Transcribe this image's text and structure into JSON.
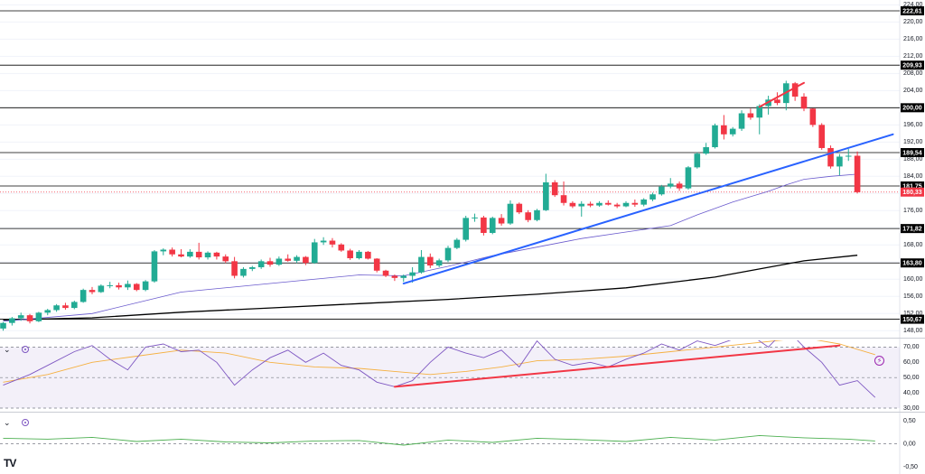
{
  "platform": {
    "logo_text": "TV"
  },
  "panes": {
    "rsi_toggle": "⌄",
    "macd_toggle": "⌄",
    "alert_icon": "⚡"
  },
  "colors": {
    "up": "#22ab94",
    "down": "#f23645",
    "ma50": "#6a5acd",
    "ma200": "#000000",
    "trend_up": "#2962ff",
    "trend_red": "#f23645",
    "rsi": "#7e57c2",
    "rsi_ma": "#f5b041",
    "macd_line": "#4caf50",
    "hline": "#000000",
    "current_price_label": "#f23645"
  },
  "chart_data": [
    {
      "type": "candlestick",
      "title": "",
      "y_axis_ticks": [
        "224,00",
        "220,00",
        "216,00",
        "212,00",
        "208,00",
        "204,00",
        "200,00",
        "196,00",
        "192,00",
        "188,00",
        "184,00",
        "180,00",
        "176,00",
        "172,00",
        "168,00",
        "164,00",
        "160,00",
        "156,00",
        "152,00",
        "148,00"
      ],
      "ylim": [
        147,
        224.5
      ],
      "horizontal_levels": [
        {
          "value": 222.61,
          "label": "222,61"
        },
        {
          "value": 209.93,
          "label": "209,93"
        },
        {
          "value": 200.0,
          "label": "200,00"
        },
        {
          "value": 189.54,
          "label": "189,54"
        },
        {
          "value": 181.75,
          "label": "181,75"
        },
        {
          "value": 171.82,
          "label": "171,82"
        },
        {
          "value": 163.8,
          "label": "163,80"
        },
        {
          "value": 150.67,
          "label": "150,67"
        }
      ],
      "current_price": {
        "value": 180.33,
        "label": "180,33"
      },
      "candles": [
        [
          148.5,
          150.0,
          148.0,
          149.8
        ],
        [
          149.8,
          151.2,
          149.2,
          150.9
        ],
        [
          150.9,
          152.2,
          150.3,
          151.6
        ],
        [
          151.6,
          151.9,
          149.7,
          150.2
        ],
        [
          150.2,
          152.4,
          150.0,
          152.2
        ],
        [
          152.2,
          153.1,
          151.6,
          152.8
        ],
        [
          152.8,
          154.2,
          152.4,
          153.9
        ],
        [
          153.9,
          154.5,
          152.9,
          153.3
        ],
        [
          153.3,
          155.0,
          153.0,
          154.7
        ],
        [
          154.7,
          157.8,
          154.5,
          157.5
        ],
        [
          157.5,
          158.2,
          156.5,
          157.0
        ],
        [
          157.0,
          158.8,
          156.8,
          158.5
        ],
        [
          158.5,
          159.4,
          157.9,
          158.6
        ],
        [
          158.6,
          159.2,
          157.6,
          158.1
        ],
        [
          158.1,
          159.7,
          157.5,
          158.9
        ],
        [
          158.9,
          159.1,
          157.2,
          157.5
        ],
        [
          157.5,
          159.8,
          157.2,
          159.5
        ],
        [
          159.5,
          166.8,
          159.2,
          166.5
        ],
        [
          166.5,
          167.2,
          165.6,
          166.9
        ],
        [
          166.9,
          167.4,
          165.3,
          165.8
        ],
        [
          165.8,
          167.0,
          165.1,
          165.3
        ],
        [
          165.3,
          167.0,
          165.0,
          166.4
        ],
        [
          166.4,
          168.5,
          164.6,
          165.1
        ],
        [
          165.1,
          166.5,
          164.6,
          166.2
        ],
        [
          166.2,
          166.4,
          164.6,
          165.3
        ],
        [
          165.3,
          165.8,
          163.8,
          164.2
        ],
        [
          164.2,
          165.2,
          160.2,
          160.8
        ],
        [
          160.8,
          162.8,
          160.4,
          162.4
        ],
        [
          162.4,
          163.1,
          161.9,
          162.8
        ],
        [
          162.8,
          164.6,
          162.4,
          164.2
        ],
        [
          164.2,
          165.0,
          162.9,
          163.4
        ],
        [
          163.4,
          165.3,
          163.1,
          164.8
        ],
        [
          164.8,
          165.8,
          164.1,
          164.3
        ],
        [
          164.3,
          165.6,
          163.8,
          165.2
        ],
        [
          165.2,
          165.4,
          163.3,
          163.8
        ],
        [
          163.8,
          169.4,
          163.6,
          168.6
        ],
        [
          168.6,
          169.8,
          168.0,
          169.0
        ],
        [
          169.0,
          169.6,
          167.4,
          168.1
        ],
        [
          168.1,
          168.4,
          166.4,
          166.7
        ],
        [
          166.7,
          167.1,
          164.5,
          164.9
        ],
        [
          164.9,
          166.8,
          164.6,
          166.4
        ],
        [
          166.4,
          166.6,
          164.6,
          164.8
        ],
        [
          164.8,
          164.9,
          161.6,
          162.0
        ],
        [
          162.0,
          162.2,
          160.5,
          160.8
        ],
        [
          160.8,
          161.1,
          159.6,
          160.3
        ],
        [
          160.3,
          161.1,
          159.4,
          160.8
        ],
        [
          160.8,
          162.8,
          159.2,
          161.6
        ],
        [
          161.6,
          166.8,
          161.3,
          165.2
        ],
        [
          165.2,
          166.0,
          162.6,
          163.2
        ],
        [
          163.2,
          164.8,
          162.8,
          164.4
        ],
        [
          164.4,
          167.8,
          164.0,
          167.3
        ],
        [
          167.3,
          169.6,
          167.0,
          169.2
        ],
        [
          169.2,
          174.8,
          168.8,
          174.3
        ],
        [
          174.3,
          175.3,
          173.4,
          174.4
        ],
        [
          174.4,
          174.8,
          170.2,
          170.8
        ],
        [
          170.8,
          174.6,
          170.5,
          174.3
        ],
        [
          174.3,
          175.2,
          172.5,
          173.0
        ],
        [
          173.0,
          178.4,
          172.7,
          177.6
        ],
        [
          177.6,
          177.9,
          175.2,
          175.6
        ],
        [
          175.6,
          176.1,
          173.3,
          173.8
        ],
        [
          173.8,
          176.4,
          173.5,
          176.1
        ],
        [
          176.1,
          184.6,
          175.9,
          182.6
        ],
        [
          182.6,
          183.1,
          179.2,
          179.6
        ],
        [
          179.6,
          182.8,
          177.2,
          177.8
        ],
        [
          177.8,
          178.2,
          176.6,
          177.0
        ],
        [
          177.0,
          178.2,
          174.6,
          177.6
        ],
        [
          177.6,
          178.1,
          176.8,
          177.2
        ],
        [
          177.2,
          178.2,
          176.9,
          177.8
        ],
        [
          177.8,
          178.4,
          177.2,
          177.4
        ],
        [
          177.4,
          177.8,
          176.6,
          177.0
        ],
        [
          177.0,
          178.2,
          176.8,
          177.8
        ],
        [
          177.8,
          178.6,
          176.9,
          177.4
        ],
        [
          177.4,
          178.9,
          177.0,
          178.6
        ],
        [
          178.6,
          180.2,
          178.2,
          179.8
        ],
        [
          179.8,
          182.0,
          179.5,
          181.6
        ],
        [
          181.6,
          183.6,
          181.2,
          182.3
        ],
        [
          182.3,
          182.8,
          180.6,
          181.2
        ],
        [
          181.2,
          186.4,
          180.9,
          186.1
        ],
        [
          186.1,
          189.6,
          185.8,
          189.3
        ],
        [
          189.3,
          191.8,
          189.0,
          190.8
        ],
        [
          190.8,
          196.3,
          190.5,
          195.9
        ],
        [
          195.9,
          198.3,
          192.6,
          193.8
        ],
        [
          193.8,
          195.5,
          193.3,
          195.1
        ],
        [
          195.1,
          199.4,
          194.6,
          198.7
        ],
        [
          198.7,
          199.8,
          197.2,
          197.7
        ],
        [
          197.7,
          200.8,
          193.8,
          200.4
        ],
        [
          200.4,
          202.8,
          198.4,
          201.9
        ],
        [
          201.9,
          203.6,
          200.6,
          201.1
        ],
        [
          201.1,
          206.3,
          199.4,
          205.7
        ],
        [
          205.7,
          206.0,
          201.6,
          202.6
        ],
        [
          202.6,
          203.4,
          199.2,
          199.8
        ],
        [
          199.8,
          199.9,
          195.5,
          196.0
        ],
        [
          196.0,
          196.4,
          190.2,
          190.6
        ],
        [
          190.6,
          191.2,
          185.8,
          186.3
        ],
        [
          186.3,
          189.2,
          184.2,
          188.6
        ],
        [
          188.6,
          190.4,
          187.6,
          188.8
        ],
        [
          188.8,
          189.8,
          180.0,
          180.3
        ]
      ],
      "ma50": [
        [
          0,
          150.2
        ],
        [
          10,
          152.0
        ],
        [
          20,
          157.0
        ],
        [
          30,
          159.0
        ],
        [
          40,
          161.0
        ],
        [
          45,
          160.8
        ],
        [
          50,
          163.0
        ],
        [
          55,
          165.5
        ],
        [
          60,
          167.5
        ],
        [
          65,
          169.5
        ],
        [
          70,
          171.0
        ],
        [
          75,
          172.5
        ],
        [
          78,
          175.0
        ],
        [
          82,
          178.0
        ],
        [
          86,
          180.5
        ],
        [
          88,
          182.0
        ],
        [
          90,
          183.3
        ],
        [
          93,
          184.0
        ],
        [
          96,
          184.5
        ]
      ],
      "ma200": [
        [
          0,
          150.5
        ],
        [
          10,
          151.0
        ],
        [
          20,
          152.3
        ],
        [
          30,
          153.3
        ],
        [
          40,
          154.3
        ],
        [
          50,
          155.3
        ],
        [
          60,
          156.5
        ],
        [
          70,
          158.0
        ],
        [
          80,
          160.5
        ],
        [
          85,
          162.4
        ],
        [
          90,
          164.3
        ],
        [
          96,
          165.6
        ]
      ],
      "trendlines": [
        {
          "color": "blue",
          "from": [
            45,
            159.0
          ],
          "to": [
            100,
            193.8
          ]
        },
        {
          "color": "red",
          "from": [
            85,
            200.2
          ],
          "to": [
            90,
            205.8
          ]
        }
      ]
    },
    {
      "type": "line",
      "title": "",
      "y_axis_ticks": [
        "70,00",
        "60,00",
        "50,00",
        "40,00",
        "30,00"
      ],
      "ylim": [
        30,
        72
      ],
      "levels": [
        70,
        50,
        30
      ],
      "rsi": [
        [
          0,
          45
        ],
        [
          3,
          52
        ],
        [
          5,
          58
        ],
        [
          8,
          67
        ],
        [
          10,
          71
        ],
        [
          12,
          62
        ],
        [
          14,
          55
        ],
        [
          16,
          70
        ],
        [
          18,
          72
        ],
        [
          20,
          67
        ],
        [
          22,
          68
        ],
        [
          24,
          60
        ],
        [
          26,
          45
        ],
        [
          28,
          55
        ],
        [
          30,
          63
        ],
        [
          32,
          68
        ],
        [
          34,
          60
        ],
        [
          36,
          66
        ],
        [
          38,
          58
        ],
        [
          40,
          55
        ],
        [
          42,
          47
        ],
        [
          44,
          44
        ],
        [
          46,
          48
        ],
        [
          48,
          60
        ],
        [
          50,
          70
        ],
        [
          52,
          66
        ],
        [
          54,
          63
        ],
        [
          56,
          68
        ],
        [
          58,
          57
        ],
        [
          60,
          74
        ],
        [
          62,
          62
        ],
        [
          64,
          58
        ],
        [
          66,
          60
        ],
        [
          68,
          57
        ],
        [
          70,
          62
        ],
        [
          72,
          66
        ],
        [
          74,
          72
        ],
        [
          76,
          68
        ],
        [
          78,
          74
        ],
        [
          80,
          71
        ],
        [
          82,
          75
        ],
        [
          84,
          78
        ],
        [
          86,
          70
        ],
        [
          88,
          82
        ],
        [
          90,
          70
        ],
        [
          92,
          60
        ],
        [
          94,
          45
        ],
        [
          96,
          48
        ],
        [
          98,
          37
        ]
      ],
      "rsi_ma": [
        [
          0,
          47
        ],
        [
          5,
          52
        ],
        [
          10,
          60
        ],
        [
          15,
          64
        ],
        [
          20,
          68
        ],
        [
          25,
          66
        ],
        [
          30,
          60
        ],
        [
          35,
          57
        ],
        [
          40,
          56
        ],
        [
          44,
          54
        ],
        [
          48,
          52
        ],
        [
          52,
          54
        ],
        [
          56,
          57
        ],
        [
          60,
          61
        ],
        [
          65,
          62
        ],
        [
          70,
          64
        ],
        [
          75,
          67
        ],
        [
          80,
          70
        ],
        [
          85,
          73
        ],
        [
          90,
          76
        ],
        [
          94,
          72
        ],
        [
          98,
          65
        ]
      ],
      "trendline": {
        "from": [
          44,
          44
        ],
        "to": [
          94,
          71
        ]
      }
    },
    {
      "type": "line",
      "title": "",
      "y_axis_ticks": [
        "0,50",
        "0,00",
        "-0,50"
      ],
      "ylim": [
        -0.6,
        0.6
      ],
      "zero_level": 0,
      "macd": [
        [
          0,
          0.12
        ],
        [
          5,
          0.1
        ],
        [
          10,
          0.14
        ],
        [
          15,
          0.05
        ],
        [
          20,
          0.1
        ],
        [
          25,
          0.04
        ],
        [
          30,
          0.02
        ],
        [
          35,
          0.06
        ],
        [
          40,
          0.07
        ],
        [
          45,
          -0.03
        ],
        [
          50,
          0.08
        ],
        [
          55,
          0.03
        ],
        [
          60,
          0.12
        ],
        [
          65,
          0.09
        ],
        [
          70,
          0.05
        ],
        [
          75,
          0.14
        ],
        [
          80,
          0.08
        ],
        [
          85,
          0.18
        ],
        [
          90,
          0.13
        ],
        [
          95,
          0.1
        ],
        [
          98,
          0.06
        ]
      ]
    }
  ]
}
